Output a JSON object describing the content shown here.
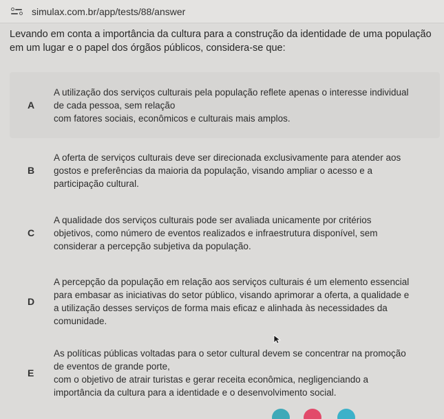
{
  "browser": {
    "url": "simulax.com.br/app/tests/88/answer"
  },
  "question": {
    "line1": "Levando em conta a importância da cultura para a construção da identidade de uma população",
    "line2": "em um lugar e o papel dos órgãos públicos, considera-se que:"
  },
  "options": [
    {
      "letter": "A",
      "lines": [
        "A utilização dos serviços culturais pela população reflete apenas o interesse individual",
        "de cada pessoa, sem relação",
        "com fatores sociais, econômicos e culturais mais amplos."
      ]
    },
    {
      "letter": "B",
      "lines": [
        "A oferta de serviços culturais deve ser direcionada exclusivamente para atender aos",
        "gostos e preferências da maioria da população, visando ampliar o acesso e a",
        "participação cultural."
      ]
    },
    {
      "letter": "C",
      "lines": [
        "A qualidade dos serviços culturais pode ser avaliada unicamente por critérios",
        "objetivos, como número de eventos realizados e infraestrutura disponível, sem",
        "considerar a percepção subjetiva da população."
      ]
    },
    {
      "letter": "D",
      "lines": [
        "A percepção da população em relação aos serviços culturais é um elemento essencial",
        "para embasar as iniciativas do setor público, visando aprimorar a oferta, a qualidade e",
        "a utilização desses serviços de forma mais eficaz e alinhada às necessidades da",
        "comunidade."
      ]
    },
    {
      "letter": "E",
      "lines": [
        "As políticas públicas voltadas para o setor cultural devem se concentrar na promoção",
        "de eventos de grande porte,",
        "com o objetivo de atrair turistas e gerar receita econômica, negligenciando a",
        "importância da cultura para a identidade e o desenvolvimento social."
      ]
    }
  ],
  "icons": {
    "site": "site-settings-icon",
    "cursor": "mouse-pointer-icon"
  },
  "colors": {
    "dot1": "#3fa9b8",
    "dot2": "#e24a6a",
    "dot3": "#3cb1c9"
  }
}
